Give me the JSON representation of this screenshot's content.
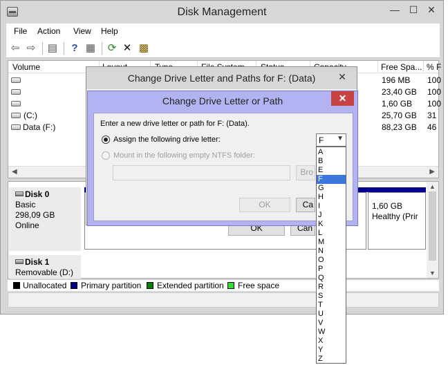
{
  "window": {
    "title": "Disk Management",
    "minimize": "—",
    "maximize": "☐",
    "close": "✕"
  },
  "menu": [
    "File",
    "Action",
    "View",
    "Help"
  ],
  "toolbar": {
    "icons": [
      "back-arrow-icon",
      "forward-arrow-icon",
      "console-tree-icon",
      "help-icon",
      "properties-icon",
      "refresh-icon",
      "delete-icon",
      "settings-icon"
    ]
  },
  "volume_list": {
    "columns": [
      "Volume",
      "Layout",
      "Type",
      "File System",
      "Status",
      "Capacity",
      "Free Spa...",
      "% F"
    ],
    "rows": [
      {
        "volume": "",
        "free": "196 MB",
        "pct": "100"
      },
      {
        "volume": "",
        "free": "23,40 GB",
        "pct": "100"
      },
      {
        "volume": "",
        "free": "1,60 GB",
        "pct": "100"
      },
      {
        "volume": "(C:)",
        "free": "25,70 GB",
        "pct": "31"
      },
      {
        "volume": "Data (F:)",
        "free": "88,23 GB",
        "pct": "46"
      }
    ]
  },
  "disks": [
    {
      "name": "Disk 0",
      "lines": [
        "Basic",
        "298,09 GB",
        "Online"
      ],
      "partition": {
        "size": "1,60 GB",
        "status": "Healthy (Prir"
      }
    },
    {
      "name": "Disk 1",
      "lines": [
        "Removable (D:)"
      ]
    }
  ],
  "legend": [
    {
      "label": "Unallocated",
      "color": "#000000"
    },
    {
      "label": "Primary partition",
      "color": "#00008b"
    },
    {
      "label": "Extended partition",
      "color": "#008000"
    },
    {
      "label": "Free space",
      "color": "#33dd33"
    }
  ],
  "outer_dialog": {
    "title": "Change Drive Letter and Paths for F: (Data)",
    "close": "✕",
    "ok": "OK",
    "cancel": "Can"
  },
  "inner_dialog": {
    "title": "Change Drive Letter or Path",
    "close": "✕",
    "instruction": "Enter a new drive letter or path for F: (Data).",
    "assign_label": "Assign the following drive letter:",
    "mount_label": "Mount in the following empty NTFS folder:",
    "browse": "Bro",
    "ok": "OK",
    "cancel": "Ca",
    "selected_letter": "F",
    "letters": [
      "A",
      "B",
      "E",
      "F",
      "G",
      "H",
      "I",
      "J",
      "K",
      "L",
      "M",
      "N",
      "O",
      "P",
      "Q",
      "R",
      "S",
      "T",
      "U",
      "V",
      "W",
      "X",
      "Y",
      "Z"
    ],
    "highlighted": "F"
  },
  "colors": {
    "selection": "#3c78dc",
    "dialog_active_frame": "#b3b3f2",
    "close_button": "#c74343"
  }
}
